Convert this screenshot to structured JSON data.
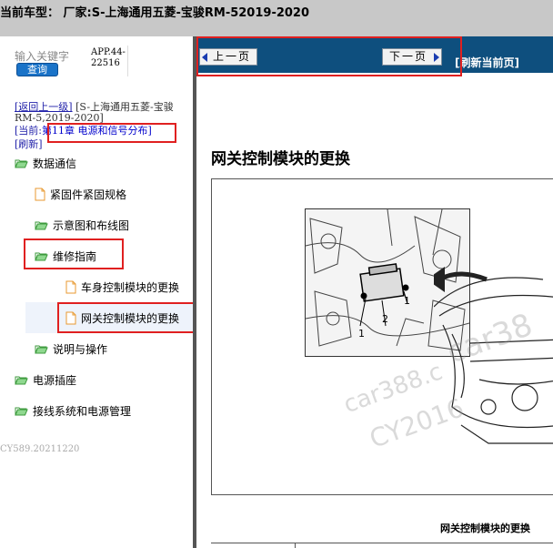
{
  "header": {
    "title": "当前车型： 厂家:S-上海通用五菱-宝骏RM-52019-2020"
  },
  "sidebar": {
    "search_placeholder": "输入关键字",
    "search_button": "查询",
    "app_code": "APP.44-22516",
    "breadcrumb_back": "[返回上一级]",
    "breadcrumb_path": "[S-上海通用五菱-宝骏RM-5,2019-2020]",
    "current_prefix": "[当前:",
    "current_chapter": "第11章 电源和信号分布]",
    "refresh": "[刷新]",
    "tree": [
      {
        "label": "数据通信",
        "icon": "folder-open-icon"
      },
      {
        "label": "紧固件紧固规格",
        "icon": "document-icon"
      },
      {
        "label": "示意图和布线图",
        "icon": "folder-open-icon"
      },
      {
        "label": "维修指南",
        "icon": "folder-open-icon"
      },
      {
        "label": "车身控制模块的更换",
        "icon": "document-icon"
      },
      {
        "label": "网关控制模块的更换",
        "icon": "document-icon"
      },
      {
        "label": "说明与操作",
        "icon": "folder-open-icon"
      },
      {
        "label": "电源插座",
        "icon": "folder-open-icon"
      },
      {
        "label": "接线系统和电源管理",
        "icon": "folder-open-icon"
      }
    ],
    "footer_code": "CY589.20211220"
  },
  "content": {
    "prev_label": "上一页",
    "next_label": "下一页",
    "refresh_current": "[刷新当前页]",
    "page_title": "网关控制模块的更换",
    "callouts": [
      "1",
      "2",
      "1"
    ],
    "watermarks": [
      "car388.c",
      "CY2016",
      "car38"
    ],
    "figure_caption": "网关控制模块的更换"
  },
  "colors": {
    "navbar": "#0e4f7e",
    "highlight_box": "#e02020",
    "search_button": "#1a73c8",
    "folder": "#5cb85c",
    "document": "#f0a030"
  }
}
